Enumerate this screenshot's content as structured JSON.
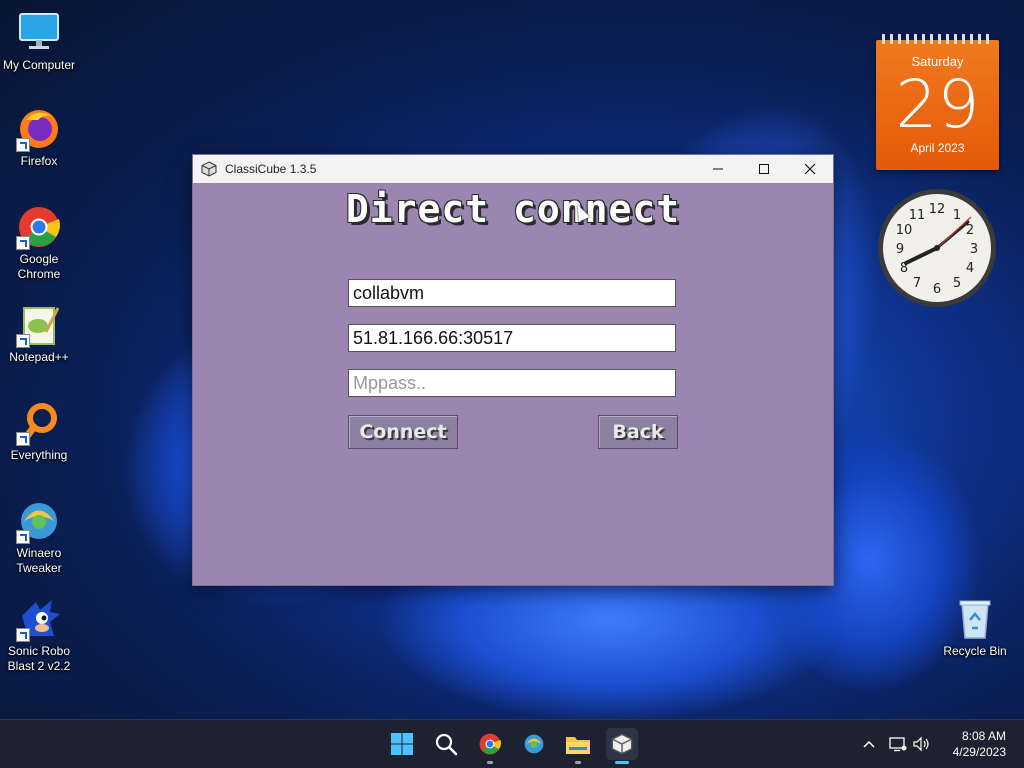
{
  "desktop": {
    "icons": [
      {
        "label": "My Computer"
      },
      {
        "label": "Firefox"
      },
      {
        "label": "Google Chrome"
      },
      {
        "label": "Notepad++"
      },
      {
        "label": "Everything"
      },
      {
        "label": "Winaero Tweaker"
      },
      {
        "label": "Sonic Robo Blast 2 v2.2"
      },
      {
        "label": "Recycle Bin"
      }
    ]
  },
  "calendar": {
    "weekday": "Saturday",
    "day": "29",
    "month_year": "April 2023"
  },
  "clock": {
    "time": "8:08"
  },
  "window": {
    "title": "ClassiCube 1.3.5",
    "heading": "Direct connect",
    "username": "collabvm",
    "address": "51.81.166.66:30517",
    "mppass_placeholder": "Mppass..",
    "connect_label": "Connect",
    "back_label": "Back"
  },
  "taskbar": {
    "apps": [
      "start-icon",
      "search-icon",
      "chrome-icon",
      "edge-icon",
      "file-explorer-icon",
      "classicube-icon"
    ],
    "time": "8:08 AM",
    "date": "4/29/2023"
  },
  "colors": {
    "window_bg": "#9a86b0",
    "calendar": "#e5590a",
    "taskbar": "#1c2230"
  }
}
